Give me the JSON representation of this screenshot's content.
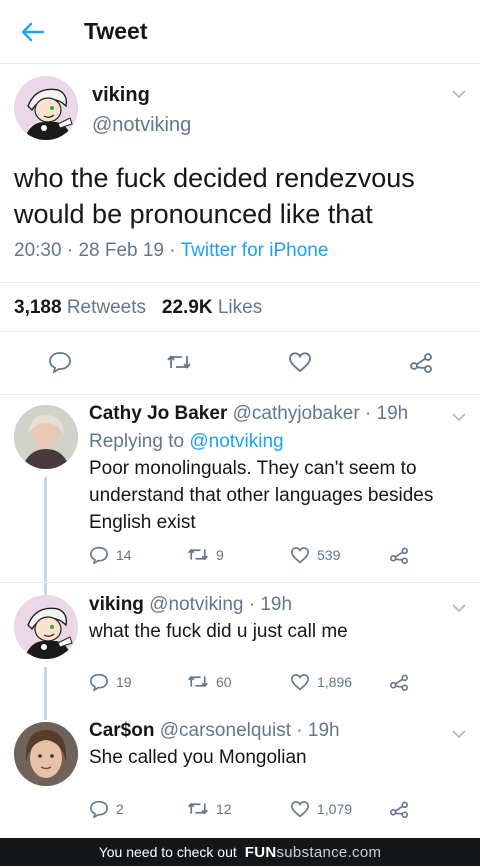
{
  "header": {
    "title": "Tweet"
  },
  "main_tweet": {
    "name": "viking",
    "handle": "@notviking",
    "text": "who the fuck decided rendezvous would be pronounced like that",
    "time": "20:30",
    "date": "28 Feb 19",
    "source": "Twitter for iPhone",
    "retweets_count": "3,188",
    "retweets_label": "Retweets",
    "likes_count": "22.9K",
    "likes_label": "Likes"
  },
  "replies": [
    {
      "name": "Cathy Jo Baker",
      "handle": "@cathyjobaker",
      "time": "19h",
      "replying_label": "Replying to",
      "replying_to": "@notviking",
      "text": "Poor monolinguals. They can't seem to understand that other languages besides English exist",
      "replies": "14",
      "retweets": "9",
      "likes": "539"
    },
    {
      "name": "viking",
      "handle": "@notviking",
      "time": "19h",
      "text": "what the fuck did u just call me",
      "replies": "19",
      "retweets": "60",
      "likes": "1,896"
    },
    {
      "name": "Car$on",
      "handle": "@carsonelquist",
      "time": "19h",
      "text": "She called you Mongolian",
      "replies": "2",
      "retweets": "12",
      "likes": "1,079"
    }
  ],
  "footer": {
    "text": "You need to check out",
    "brand_main": "FUN",
    "brand_sub": "substance",
    "brand_domain": ".com"
  },
  "colors": {
    "accent": "#1da1f2",
    "secondary": "#657786",
    "text": "#14171a",
    "border": "#e6ecf0"
  },
  "icons": [
    "back-arrow-icon",
    "chevron-down-icon",
    "reply-icon",
    "retweet-icon",
    "like-icon",
    "share-icon"
  ]
}
